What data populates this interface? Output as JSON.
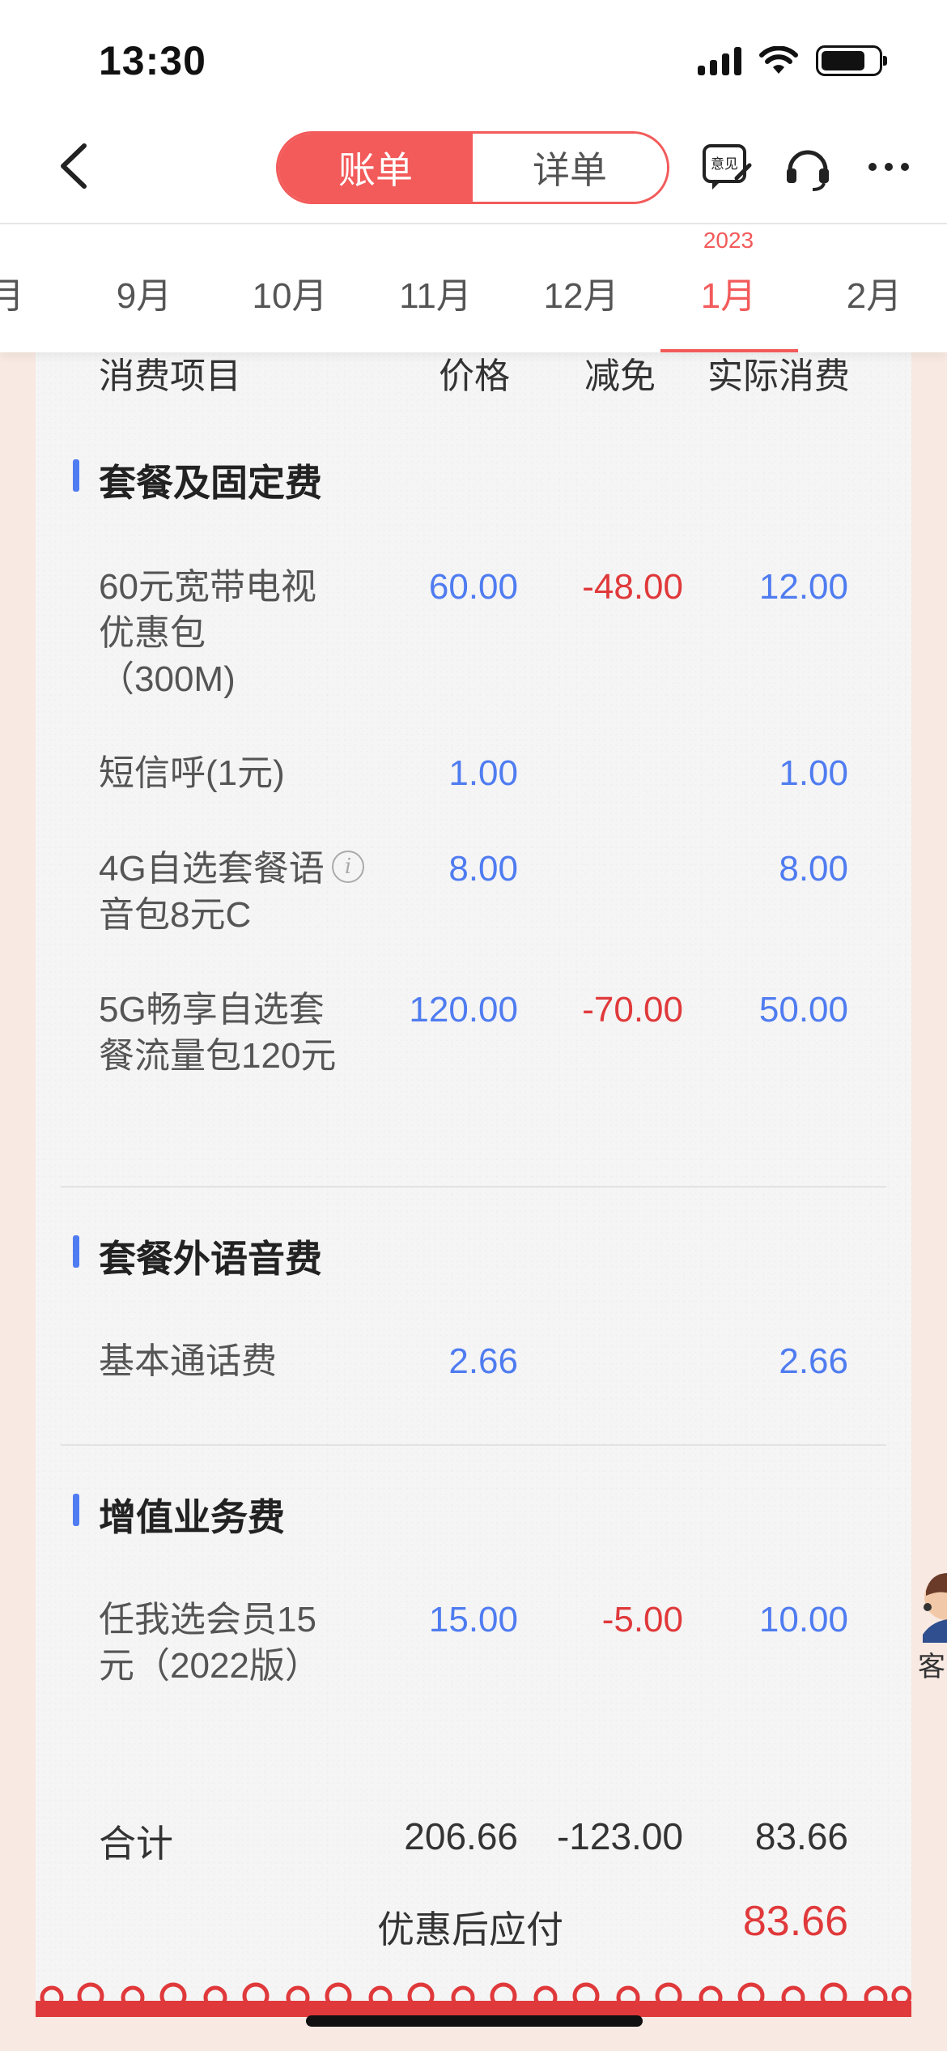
{
  "status_bar": {
    "time": "13:30"
  },
  "nav": {
    "segments": [
      {
        "label": "账单",
        "active": true
      },
      {
        "label": "详单",
        "active": false
      }
    ],
    "feedback_icon_text": "意见",
    "icons": [
      "back-icon",
      "feedback-icon",
      "headset-icon",
      "more-icon"
    ]
  },
  "months": {
    "partial_left": "月",
    "items": [
      "9月",
      "10月",
      "11月",
      "12月",
      "1月",
      "2月"
    ],
    "active": "1月",
    "active_year": "2023"
  },
  "table": {
    "headers": [
      "消费项目",
      "价格",
      "减免",
      "实际消费"
    ],
    "sections": [
      {
        "title": "套餐及固定费",
        "rows": [
          {
            "name": "60元宽带电视优惠包（300M)",
            "price": "60.00",
            "discount": "-48.00",
            "actual": "12.00"
          },
          {
            "name": "短信呼(1元)",
            "price": "1.00",
            "discount": "",
            "actual": "1.00"
          },
          {
            "name": "4G自选套餐语音包8元C",
            "price": "8.00",
            "discount": "",
            "actual": "8.00",
            "info": true
          },
          {
            "name": "5G畅享自选套餐流量包120元",
            "price": "120.00",
            "discount": "-70.00",
            "actual": "50.00"
          }
        ]
      },
      {
        "title": "套餐外语音费",
        "rows": [
          {
            "name": "基本通话费",
            "price": "2.66",
            "discount": "",
            "actual": "2.66"
          }
        ]
      },
      {
        "title": "增值业务费",
        "rows": [
          {
            "name": "任我选会员15元（2022版）",
            "price": "15.00",
            "discount": "-5.00",
            "actual": "10.00"
          }
        ]
      }
    ],
    "total": {
      "label": "合计",
      "price": "206.66",
      "discount": "-123.00",
      "actual": "83.66"
    },
    "payable": {
      "label": "优惠后应付",
      "value": "83.66"
    }
  },
  "customer_service": {
    "label": "客"
  },
  "colors": {
    "accent": "#f35a5a",
    "blue": "#4f7cf0",
    "red": "#e0393b",
    "background": "#f8e9e2"
  }
}
